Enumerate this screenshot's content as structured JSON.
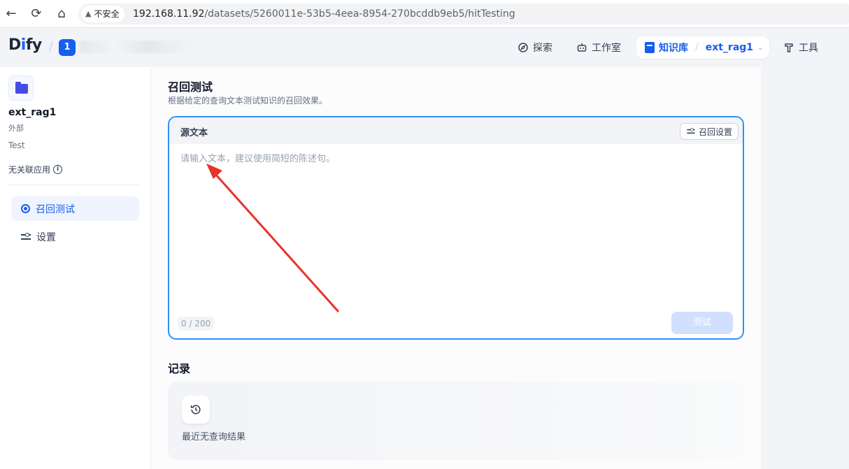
{
  "browser": {
    "security_label": "不安全",
    "url_host": "192.168.11.92",
    "url_path": "/datasets/5260011e-53b5-4eea-8954-270bcddb9eb5/hitTesting"
  },
  "header": {
    "logo_d": "D",
    "logo_i": "i",
    "logo_fy": "fy",
    "workspace_initial": "1",
    "nav": {
      "explore": "探索",
      "studio": "工作室",
      "knowledge": "知识库",
      "dataset_selector": "ext_rag1",
      "tools": "工具"
    },
    "icons": {
      "explore": "compass-icon",
      "studio": "robot-icon",
      "knowledge": "book-icon",
      "tools": "hammer-icon"
    }
  },
  "sidebar": {
    "dataset_name": "ext_rag1",
    "dataset_type": "外部",
    "dataset_description": "Test",
    "linked_apps": "无关联应用",
    "items": [
      {
        "label": "召回测试",
        "icon": "target-icon",
        "active": true
      },
      {
        "label": "设置",
        "icon": "settings-icon",
        "active": false
      }
    ]
  },
  "main": {
    "title": "召回测试",
    "subtitle": "根据给定的查询文本测试知识的召回效果。",
    "query": {
      "label": "源文本",
      "retrieval_settings": "召回设置",
      "placeholder": "请输入文本，建议使用简短的陈述句。",
      "value": "",
      "counter": "0 / 200",
      "test_button": "测试"
    },
    "records": {
      "title": "记录",
      "empty_text": "最近无查询结果"
    }
  },
  "colors": {
    "accent": "#155eef",
    "focus_border": "#2e90fa",
    "disabled_button": "#d1e0ff",
    "annotation_arrow": "#e8322a"
  }
}
